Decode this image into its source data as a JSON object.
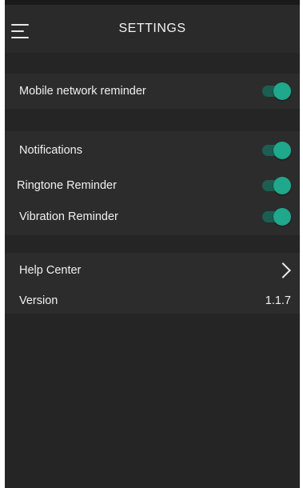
{
  "header": {
    "title": "SETTINGS",
    "menu_icon": "hamburger-menu-icon"
  },
  "settings": {
    "mobile_network_reminder": {
      "label": "Mobile network reminder",
      "enabled": true
    },
    "notifications": {
      "label": "Notifications",
      "enabled": true
    },
    "ringtone_reminder": {
      "label": "Ringtone Reminder",
      "enabled": true
    },
    "vibration_reminder": {
      "label": "Vibration Reminder",
      "enabled": true
    },
    "help_center": {
      "label": "Help Center",
      "icon": "chevron-right-icon"
    },
    "version": {
      "label": "Version",
      "value": "1.1.7"
    }
  },
  "colors": {
    "background": "#252525",
    "toggle_accent": "#1fa88b",
    "toggle_track": "#1c5f52"
  }
}
